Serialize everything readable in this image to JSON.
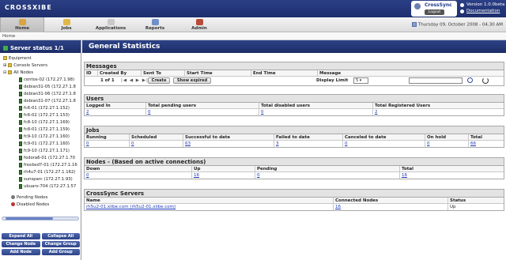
{
  "header": {
    "logo": "CROSSXIBE",
    "user_name": "CrossSync",
    "logout_label": "Logout",
    "version": "Version 1.0.0beta",
    "documentation": "Documentation"
  },
  "nav": {
    "tabs": [
      {
        "label": "Home",
        "icon": "home-icon"
      },
      {
        "label": "Jobs",
        "icon": "jobs-icon"
      },
      {
        "label": "Applications",
        "icon": "applications-icon"
      },
      {
        "label": "Reports",
        "icon": "reports-icon"
      },
      {
        "label": "Admin",
        "icon": "admin-icon"
      }
    ],
    "datetime": "Thursday 09, October 2008 - 04:30 AM"
  },
  "breadcrumb": "Home",
  "sidebar": {
    "title": "Server status 1/1",
    "tree": {
      "equipment": "Equipment",
      "console_servers": "Console Servers",
      "all_nodes": "All Nodes",
      "nodes": [
        "centos-02 (172.27.1.98)",
        "debian31-05 (172.27.1.8",
        "debian31-06 (172.27.1.8",
        "debian31-07 (172.27.1.8",
        "fc6-01 (172.27.1.152)",
        "fc6-02 (172.27.1.153)",
        "fc8-10 (172.27.1.169)",
        "fc8-01 (172.27.1.159)",
        "fc9-10 (172.27.1.160)",
        "fc9-01 (172.27.1.160)",
        "fc9-10 (172.27.1.171)",
        "fedora6-01 (172.27.1.70",
        "freebsd7-01 (172.27.1.16",
        "rh4u7-01 (172.27.1.162)",
        "sunsparc (172.27.1.93)",
        "ubuarv-704 (172.27.1.57"
      ],
      "pending_nodes": "Pending Nodes",
      "disabled_nodes": "Disabled Nodes"
    },
    "buttons": [
      "Expand All",
      "Collapse All",
      "Change Node",
      "Change Group",
      "Add Node",
      "Add Group"
    ]
  },
  "main": {
    "title": "General Statistics",
    "messages": {
      "title": "Messages",
      "columns": [
        "ID",
        "Created By",
        "Sent To",
        "Start Time",
        "End Time",
        "Message"
      ],
      "pager": "1 of 1",
      "pager_arrows": "|◀ ◀ ▶ ▶|",
      "create_label": "Create",
      "show_expired_label": "Show expired",
      "display_limit_label": "Display Limit",
      "display_limit_value": "5 ▾",
      "search_placeholder": ""
    },
    "users": {
      "title": "Users",
      "columns": [
        "Logged In",
        "Total pending users",
        "Total disabled users",
        "Total Registered Users"
      ],
      "values": [
        "2",
        "0",
        "0",
        "2"
      ]
    },
    "jobs": {
      "title": "Jobs",
      "columns": [
        "Running",
        "Scheduled",
        "Successful to date",
        "Failed to date",
        "Canceled to date",
        "On hold",
        "Total"
      ],
      "values": [
        "0",
        "0",
        "63",
        "3",
        "0",
        "0",
        "66"
      ]
    },
    "nodes": {
      "title": "Nodes - (Based on active connections)",
      "columns": [
        "Down",
        "Up",
        "Pending",
        "Total"
      ],
      "values": [
        "0",
        "16",
        "0",
        "16"
      ]
    },
    "servers": {
      "title": "CrossSync Servers",
      "columns": [
        "Name",
        "Connected Nodes",
        "Status"
      ],
      "values": [
        "rh5u2-01.xiibe.com (rh5u2-01.xiibe.com)",
        "16",
        "Up"
      ]
    }
  },
  "colors": {
    "header_blue": "#2b3f86",
    "link_blue": "#1a39b8",
    "status_green": "#3cb043"
  }
}
